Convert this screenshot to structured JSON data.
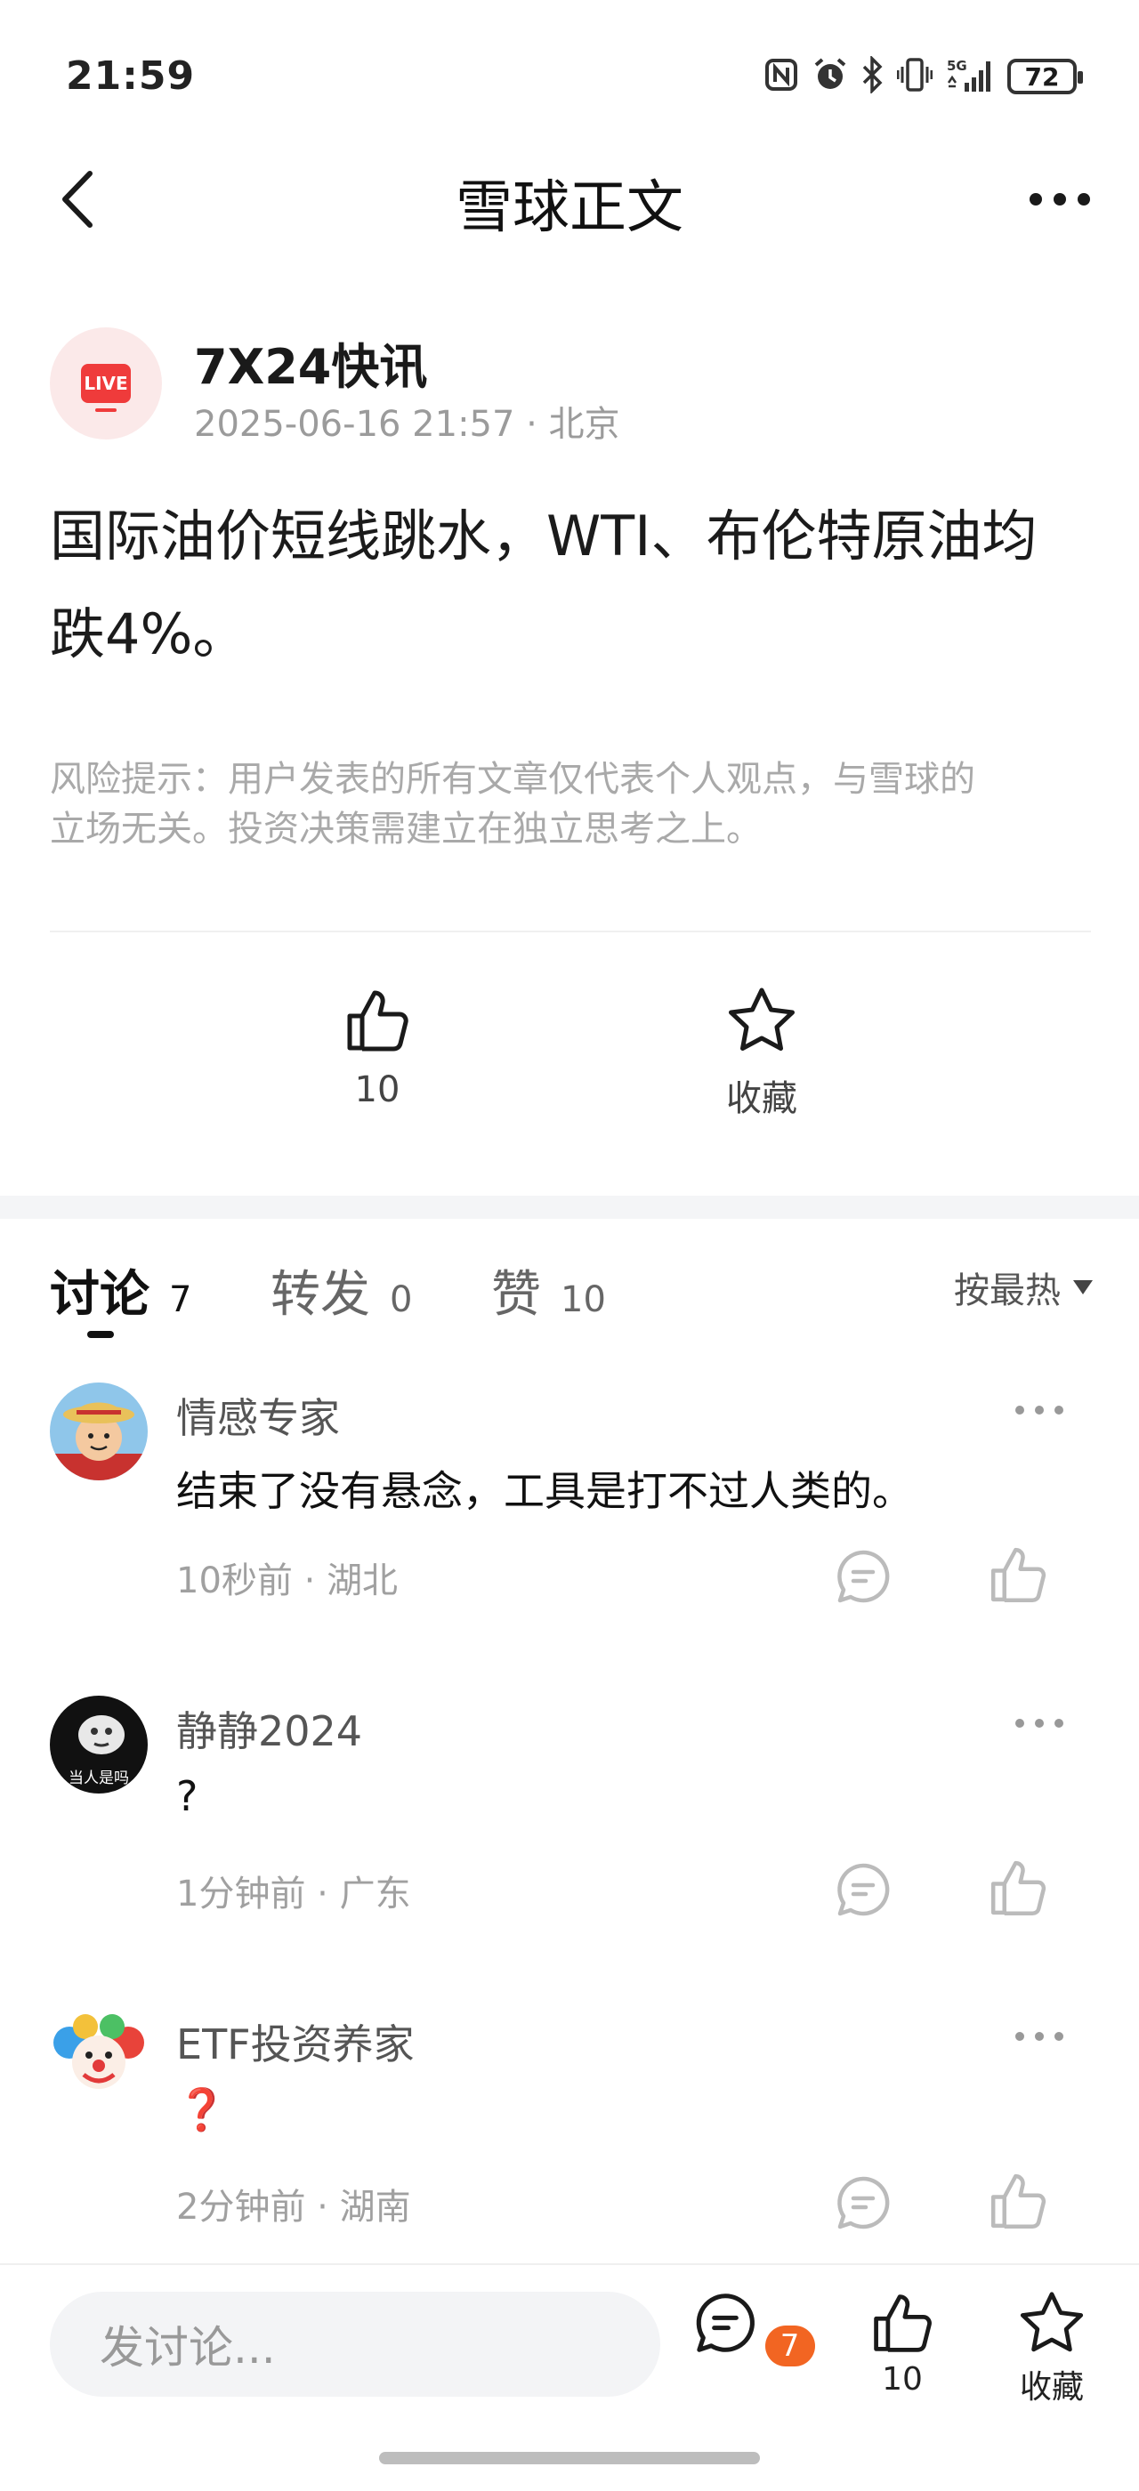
{
  "status_bar": {
    "time": "21:59",
    "network": "5G",
    "battery": "72",
    "icons": [
      "nfc-icon",
      "alarm-icon",
      "bluetooth-icon",
      "vibrate-icon",
      "signal-icon",
      "battery-icon"
    ]
  },
  "nav": {
    "title": "雪球正文",
    "back_icon": "chevron-left-icon",
    "more_icon": "more-horizontal-icon"
  },
  "post": {
    "author": {
      "name": "7X24快讯",
      "avatar_badge": "LIVE",
      "time": "2025-06-16 21:57",
      "location": "北京"
    },
    "content_line1": "国际油价短线跳水，WTI、布伦特原油均",
    "content_line2": "跌4%。",
    "risk_line1": "风险提示：用户发表的所有文章仅代表个人观点，与雪球的",
    "risk_line2": "立场无关。投资决策需建立在独立思考之上。",
    "like_count": "10",
    "favorite_label": "收藏"
  },
  "tabs": [
    {
      "label": "讨论",
      "count": "7"
    },
    {
      "label": "转发",
      "count": "0"
    },
    {
      "label": "赞",
      "count": "10"
    }
  ],
  "sort_label": "按最热",
  "comments": [
    {
      "name": "情感专家",
      "text": "结束了没有悬念，工具是打不过人类的。",
      "time": "10秒前",
      "location": "湖北"
    },
    {
      "name": "静静2024",
      "text": "?",
      "time": "1分钟前",
      "location": "广东",
      "avatar_text": "当人是吗"
    },
    {
      "name": "ETF投资养家",
      "text": "❓",
      "time": "2分钟前",
      "location": "湖南"
    }
  ],
  "bottom_bar": {
    "input_placeholder": "发讨论...",
    "comment_badge": "7",
    "like_count": "10",
    "favorite_label": "收藏"
  },
  "colors": {
    "accent_orange": "#f26522",
    "live_red": "#ef3b3b",
    "muted_text": "#a0a0a0"
  }
}
